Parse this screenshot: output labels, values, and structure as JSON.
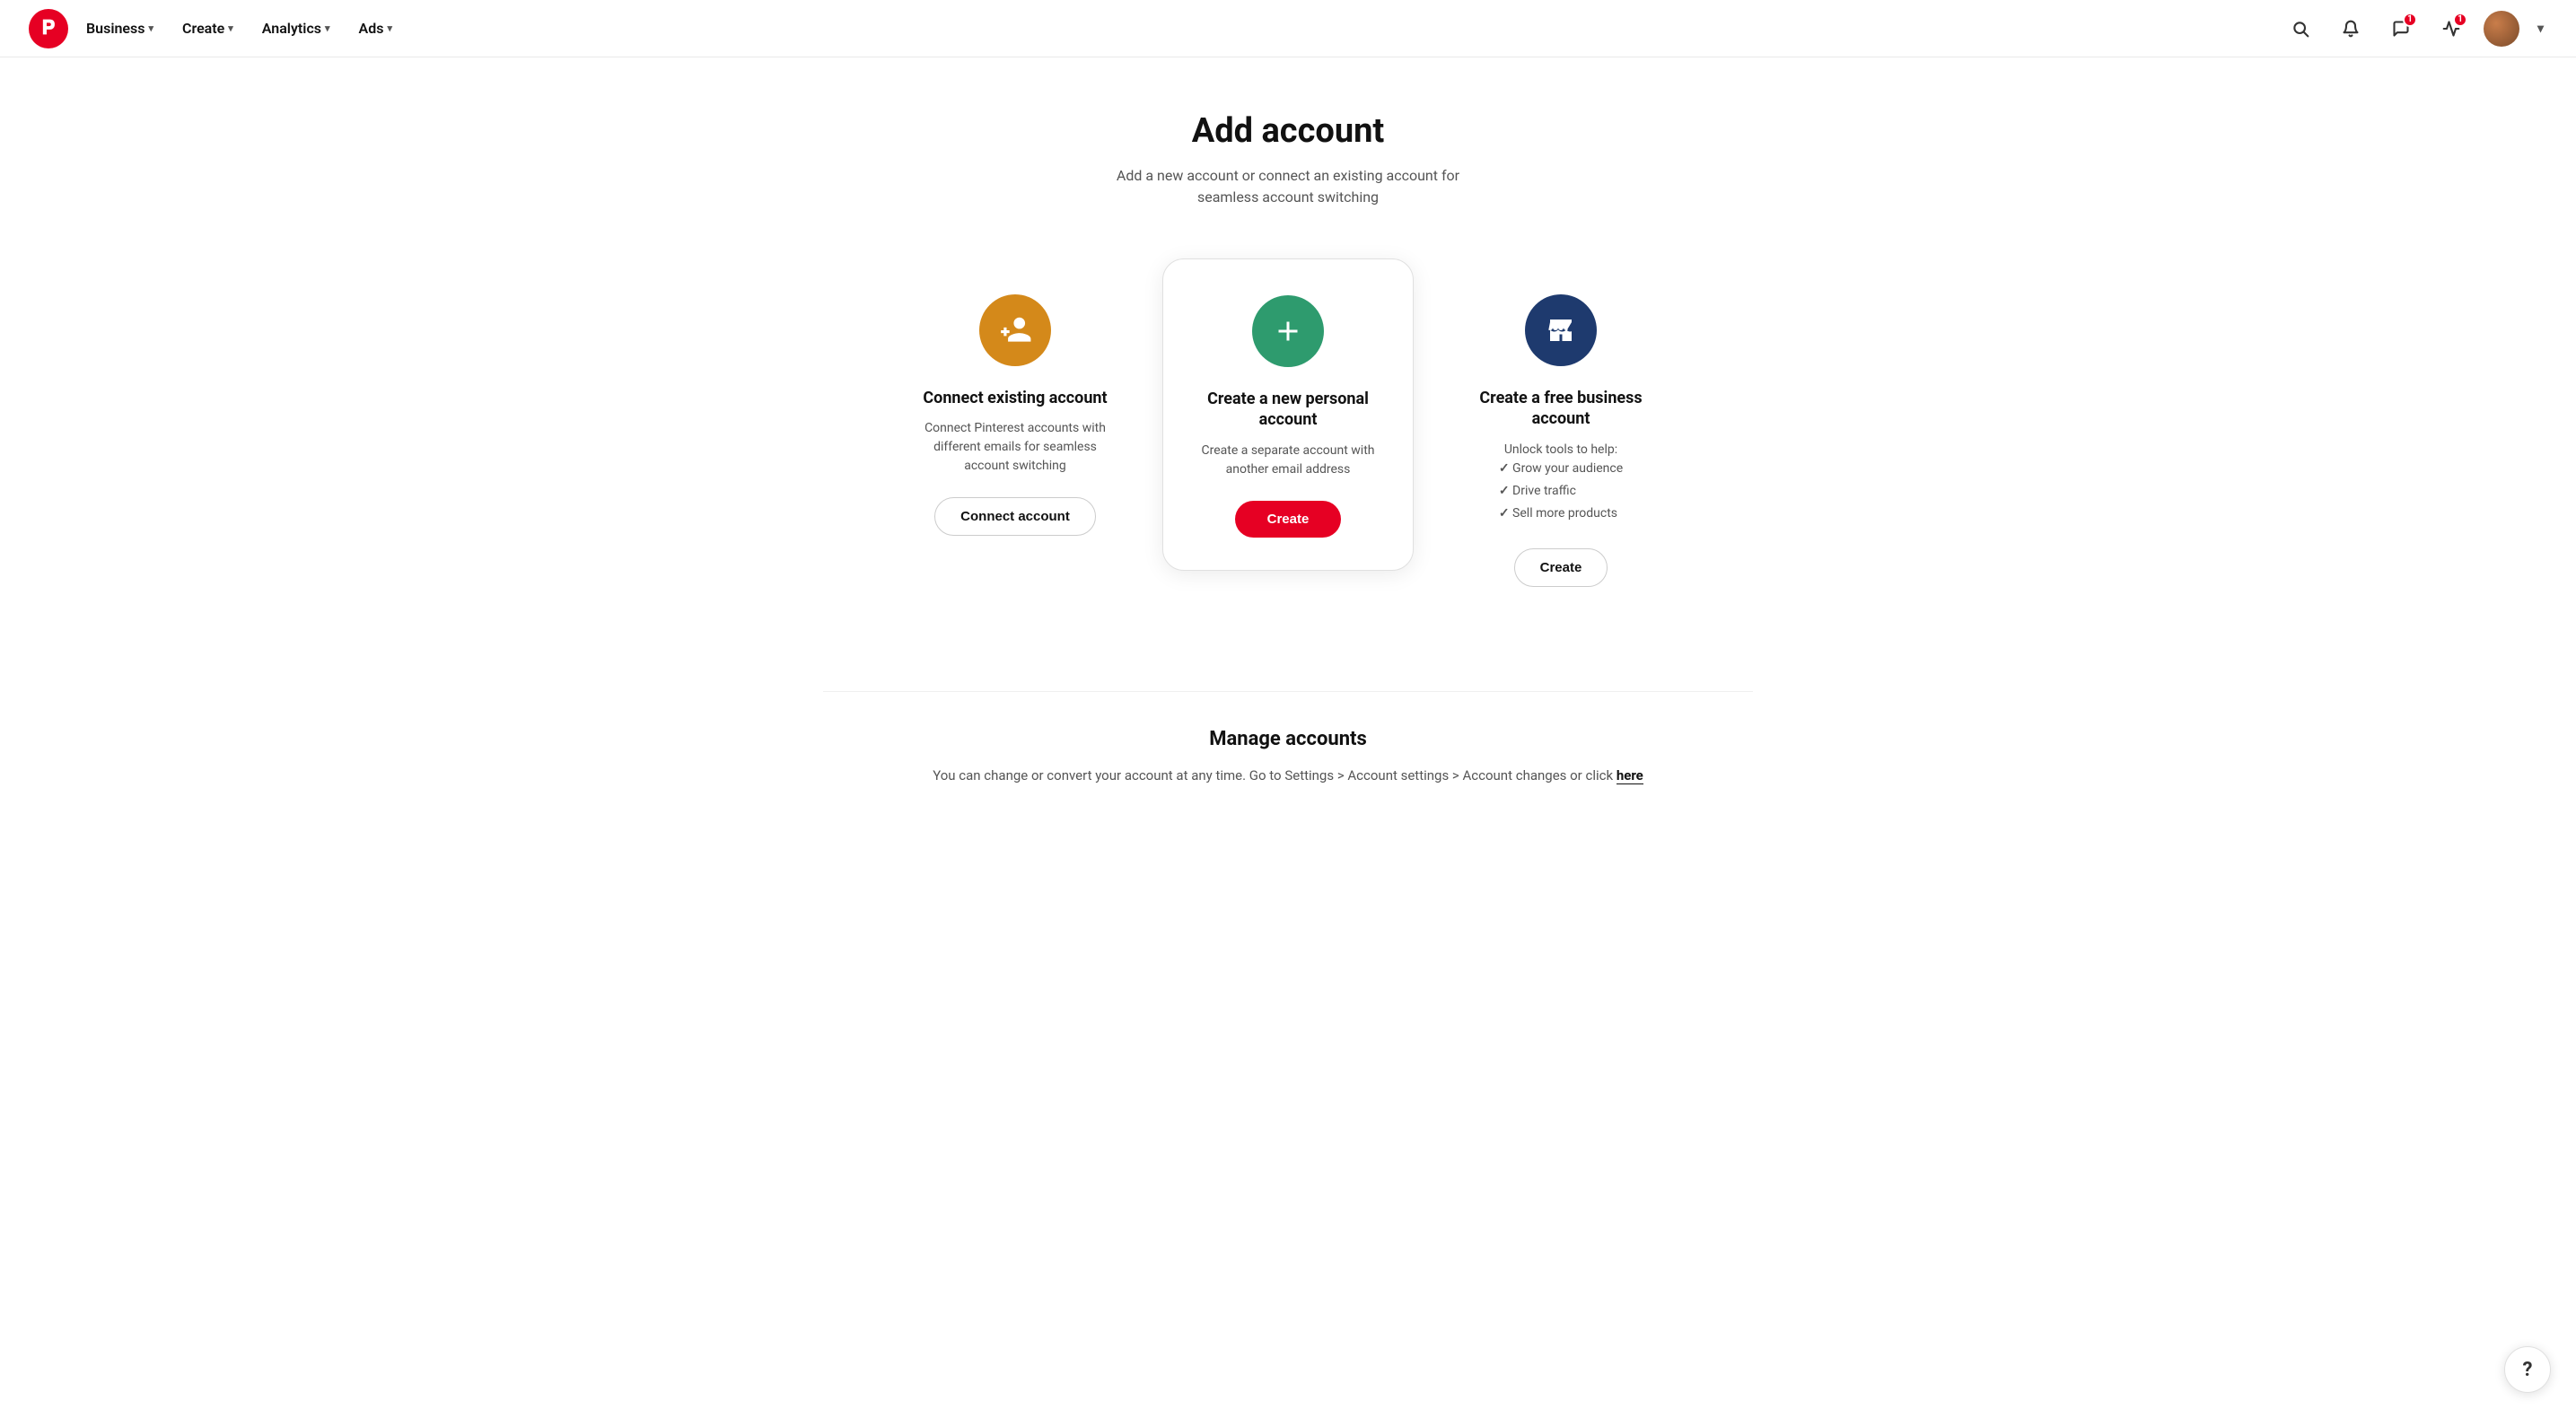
{
  "nav": {
    "logo_alt": "Pinterest",
    "items": [
      {
        "label": "Business",
        "id": "business"
      },
      {
        "label": "Create",
        "id": "create"
      },
      {
        "label": "Analytics",
        "id": "analytics"
      },
      {
        "label": "Ads",
        "id": "ads"
      }
    ],
    "right": {
      "search_label": "Search",
      "notifications_label": "Notifications",
      "messages_label": "Messages",
      "messages_badge": "1",
      "notifications_badge": "1",
      "profile_label": "Profile",
      "more_label": "More"
    }
  },
  "page": {
    "title": "Add account",
    "subtitle": "Add a new account or connect an existing account for\nseamless account switching"
  },
  "cards": [
    {
      "id": "connect-existing",
      "icon_name": "add-person-icon",
      "icon_color": "orange",
      "title": "Connect existing account",
      "description": "Connect Pinterest accounts with different emails for seamless account switching",
      "button_label": "Connect account",
      "button_type": "outline"
    },
    {
      "id": "create-personal",
      "icon_name": "plus-icon",
      "icon_color": "green",
      "title": "Create a new personal account",
      "description": "Create a separate account with another email address",
      "button_label": "Create",
      "button_type": "red",
      "highlighted": true
    },
    {
      "id": "create-business",
      "icon_name": "store-icon",
      "icon_color": "navy",
      "title": "Create a free business account",
      "description_list": [
        "Grow your audience",
        "Drive traffic",
        "Sell more products"
      ],
      "description_prefix": "Unlock tools to help:",
      "button_label": "Create",
      "button_type": "outline"
    }
  ],
  "manage": {
    "title": "Manage accounts",
    "description": "You can change or convert your account at any time. Go to Settings > Account settings > Account changes or click",
    "link_label": "here"
  },
  "help": {
    "label": "?"
  }
}
